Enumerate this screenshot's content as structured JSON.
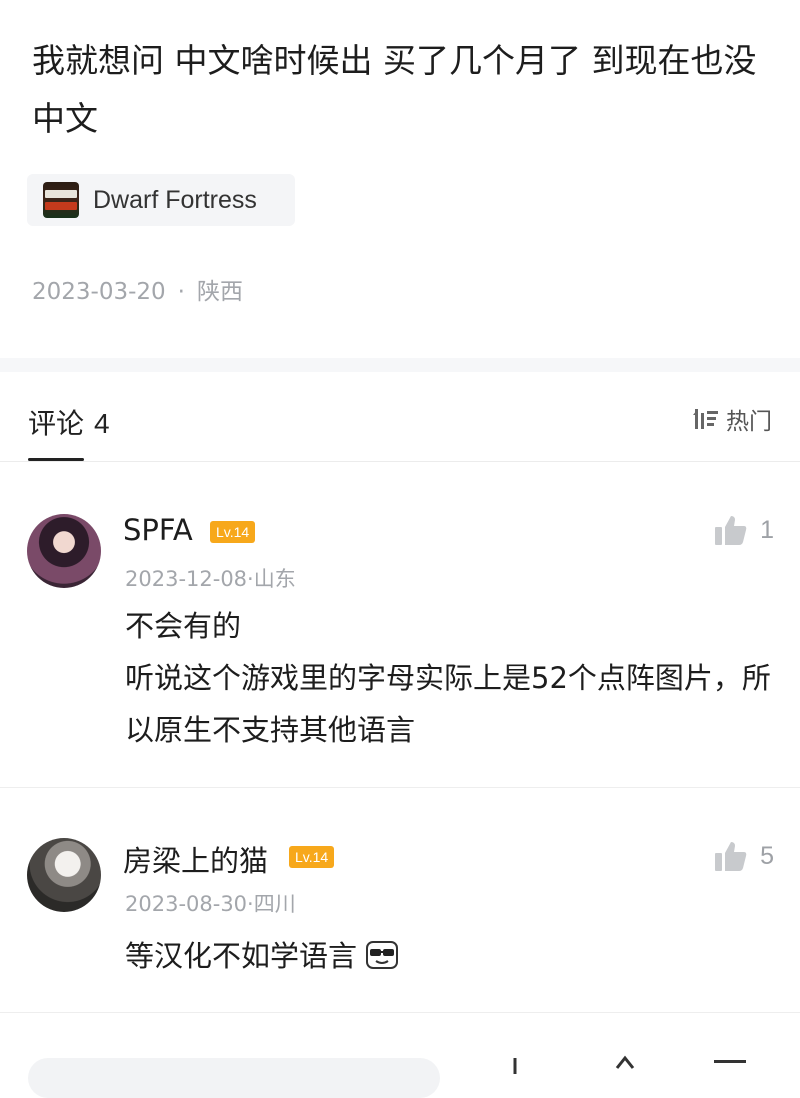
{
  "post": {
    "text": "我就想问 中文啥时候出 买了几个月了 到现在也没中文",
    "game_tag": "Dwarf Fortress",
    "date": "2023-03-20",
    "location": "陕西"
  },
  "comments_header": {
    "label": "评论",
    "count": "4",
    "sort_label": "热门"
  },
  "comments": [
    {
      "username": "SPFA",
      "level": "Lv.14",
      "date": "2023-12-08",
      "location": "山东",
      "line1": "不会有的",
      "line2": "听说这个游戏里的字母实际上是52个点阵图片，所以原生不支持其他语言",
      "likes": "1"
    },
    {
      "username": "房梁上的猫",
      "level": "Lv.14",
      "date": "2023-08-30",
      "location": "四川",
      "line1": "等汉化不如学语言",
      "likes": "5"
    }
  ],
  "colors": {
    "level_badge": "#f7a81b",
    "meta_gray": "#a3a6ab",
    "text": "#1d1d1d"
  }
}
